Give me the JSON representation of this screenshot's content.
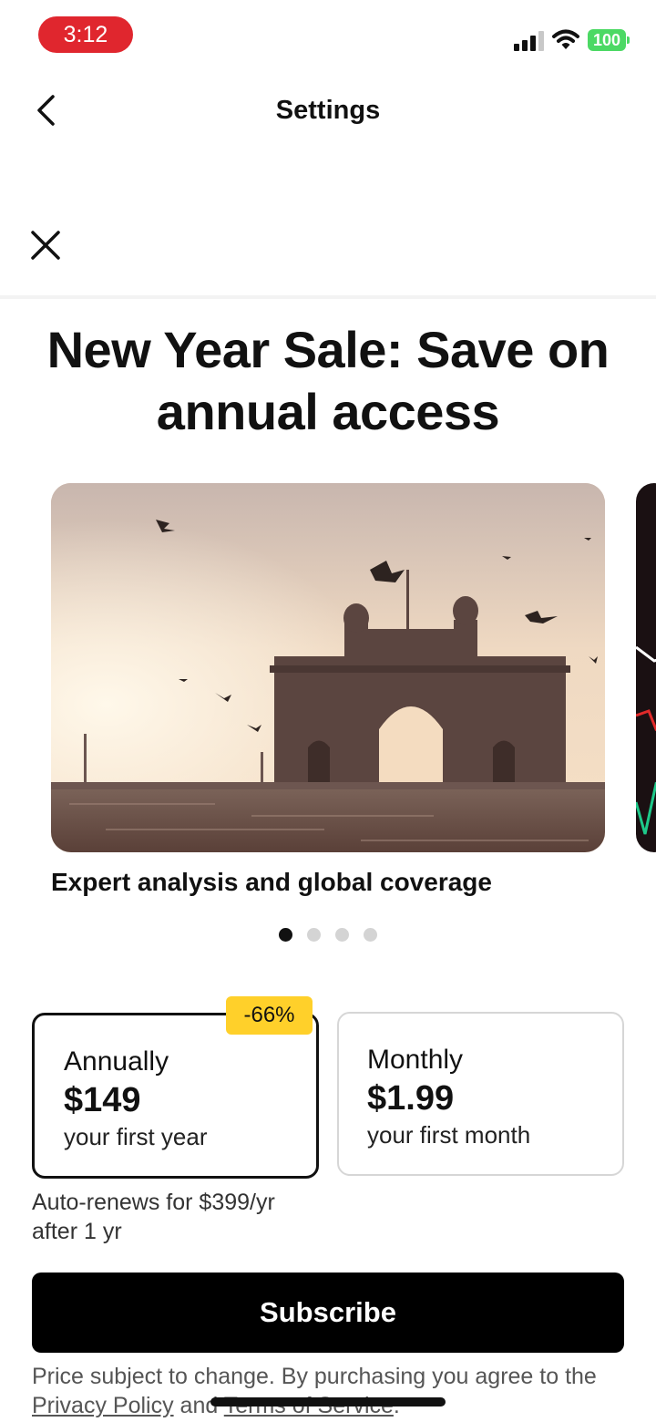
{
  "status_bar": {
    "time": "3:12",
    "battery": "100"
  },
  "nav": {
    "title": "Settings",
    "back_icon": "chevron-left-icon"
  },
  "close_icon": "close-icon",
  "headline": "New Year Sale: Save on annual access",
  "carousel": {
    "caption": "Expert analysis and global coverage",
    "pages": 4,
    "active_page": 1
  },
  "plans": [
    {
      "name": "Annually",
      "price": "$149",
      "term": "your first year",
      "badge": "-66%",
      "selected": true
    },
    {
      "name": "Monthly",
      "price": "$1.99",
      "term": "your first month",
      "selected": false
    }
  ],
  "renewal_note": "Auto-renews for $399/yr after 1 yr",
  "subscribe_label": "Subscribe",
  "legal": {
    "prefix": "Price subject to change. By purchasing you agree to the ",
    "privacy_link": "Privacy Policy",
    "and": " and ",
    "terms_link": "Terms of Service",
    "suffix": "."
  },
  "colors": {
    "time_pill": "#e0262e",
    "badge": "#ffd02a",
    "battery": "#4cd964",
    "button": "#000000"
  }
}
